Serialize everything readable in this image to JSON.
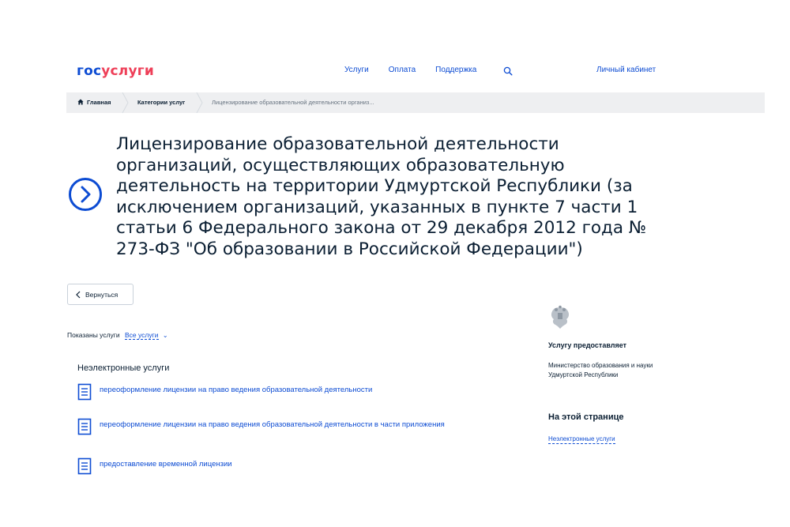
{
  "header": {
    "logo_part1": "гос",
    "logo_part2": "услуги",
    "nav": [
      "Услуги",
      "Оплата",
      "Поддержка"
    ],
    "search_icon": "search-icon",
    "cabinet": "Личный кабинет"
  },
  "breadcrumb": {
    "home": "Главная",
    "category": "Категории услуг",
    "current": "Лицензирование образовательной деятельности организ..."
  },
  "page": {
    "title": "Лицензирование образовательной деятельности организаций, осуществляющих образовательную деятельность на территории Удмуртской Республики (за исключением организаций, указанных в пункте 7 части 1 статьи 6 Федерального закона от 29 декабря 2012 года № 273-ФЗ \"Об образовании в Российской Федерации\")",
    "back": "Вернуться"
  },
  "filter": {
    "label": "Показаны услуги",
    "value": "Все услуги"
  },
  "services": {
    "section_title": "Неэлектронные услуги",
    "items": [
      "переоформление лицензии на право ведения образовательной деятельности",
      "переоформление лицензии на право ведения образовательной деятельности в части приложения",
      "предоставление временной лицензии"
    ]
  },
  "sidebar": {
    "provider_label": "Услугу предоставляет",
    "provider_name": "Министерство образования и науки Удмуртской Республики",
    "on_page_title": "На этой странице",
    "on_page_link": "Неэлектронные услуги"
  },
  "colors": {
    "brand_blue": "#0d4cd3",
    "brand_red": "#ee3f58",
    "text": "#0b1f33",
    "breadcrumb_bg": "#eeeff1"
  }
}
